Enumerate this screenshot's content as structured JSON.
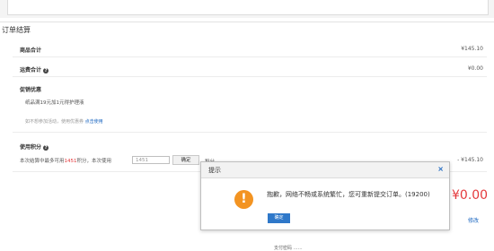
{
  "section": {
    "title": "订单结算"
  },
  "rows": {
    "subtotal_label": "商品合计",
    "subtotal_amount": "¥145.10",
    "shipping_label": "运费合计",
    "shipping_amount": "¥0.00",
    "promo_label": "促销优惠",
    "promo_text": "纸品满19元加1元得护理液",
    "promo_note": "如不想参加活动，使用优惠券",
    "promo_link": "点击使用",
    "points_label": "使用积分",
    "points_text_pre": "本次结算中最多可用",
    "points_max": "1451",
    "points_text_post": "积分，本次使用",
    "points_value": "1451",
    "points_confirm": "确定",
    "points_suffix": "积分",
    "points_amount": "- ¥145.10"
  },
  "total": {
    "amount": "¥0.00",
    "edit": "修改",
    "partial": "1"
  },
  "footer_partial": "支付密码 ……",
  "dialog": {
    "title": "提示",
    "close": "×",
    "icon": "!",
    "message": "抱歉，网络不畅或系统繁忙，您可重新提交订单。(19200)",
    "ok": "确定"
  },
  "colors": {
    "accent": "#2f78c9",
    "price": "#e4393c",
    "warning": "#f39422"
  }
}
